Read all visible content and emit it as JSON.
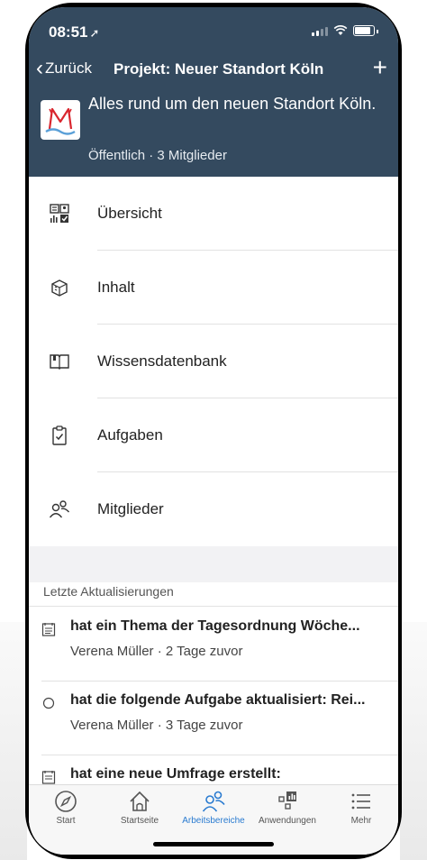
{
  "status": {
    "time": "08:51",
    "location_glyph": "➚"
  },
  "nav": {
    "back_label": "Zurück",
    "title": "Projekt: Neuer Standort Köln",
    "add_glyph": "+"
  },
  "project": {
    "description": "Alles rund um den neuen Standort Köln.",
    "meta": "Öffentlich · 3 Mitglieder"
  },
  "menu": {
    "items": [
      {
        "label": "Übersicht",
        "icon": "overview-icon"
      },
      {
        "label": "Inhalt",
        "icon": "content-icon"
      },
      {
        "label": "Wissensdatenbank",
        "icon": "book-icon"
      },
      {
        "label": "Aufgaben",
        "icon": "clipboard-check-icon"
      },
      {
        "label": "Mitglieder",
        "icon": "people-icon"
      }
    ]
  },
  "updates": {
    "title": "Letzte Aktualisierungen",
    "items": [
      {
        "title": "hat ein Thema der Tagesordnung Wöche...",
        "subtitle": "Verena Müller · 2 Tage zuvor",
        "icon": "agenda-icon"
      },
      {
        "title": "hat die folgende Aufgabe aktualisiert: Rei...",
        "subtitle": "Verena Müller · 3 Tage zuvor",
        "icon": "circle-icon"
      },
      {
        "title": "hat eine neue Umfrage erstellt:",
        "subtitle": "",
        "icon": "agenda-icon"
      }
    ]
  },
  "tabbar": {
    "tabs": [
      {
        "label": "Start",
        "icon": "compass-icon"
      },
      {
        "label": "Startseite",
        "icon": "home-icon"
      },
      {
        "label": "Arbeitsbereiche",
        "icon": "people-icon",
        "active": true
      },
      {
        "label": "Anwendungen",
        "icon": "apps-icon"
      },
      {
        "label": "Mehr",
        "icon": "menu-icon"
      }
    ]
  },
  "colors": {
    "header": "#344a5f",
    "active_tab": "#2a7bd0",
    "logo_red": "#d9262e",
    "logo_blue": "#5aa0d8"
  }
}
